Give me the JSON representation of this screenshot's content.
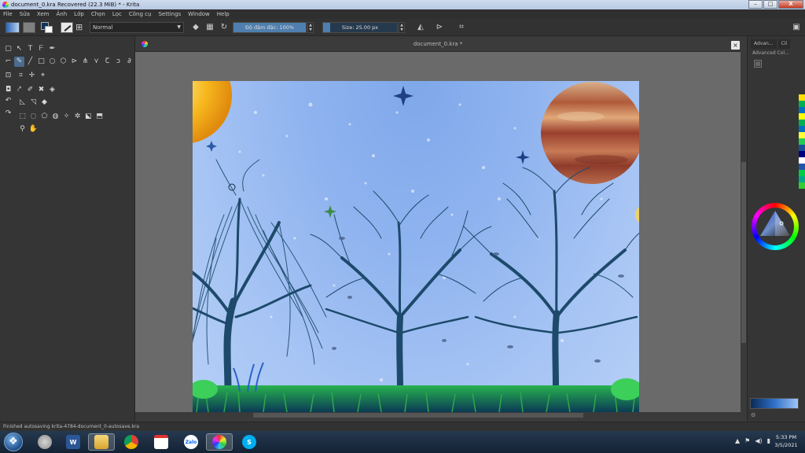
{
  "window": {
    "title": "document_0.kra Recovered  (22.3 MiB)  * - Krita",
    "minimize_label": "–",
    "maximize_label": "□",
    "close_label": "X"
  },
  "menu": [
    "File",
    "Sửa",
    "Xem",
    "Ảnh",
    "Lớp",
    "Chọn",
    "Lọc",
    "Công cụ",
    "Settings",
    "Window",
    "Help"
  ],
  "toolbar": {
    "blend_mode": "Normal",
    "opacity_label": "Độ đậm đặc: 100%",
    "opacity_value": 100,
    "size_label": "Size: 25.00 px",
    "size_fill": 0.1
  },
  "document": {
    "tab_title": "document_0.kra *",
    "close_label": "×"
  },
  "docker": {
    "tabs": [
      "Advan...",
      "Cil"
    ],
    "title": "Advanced Col...",
    "palette": [
      "#ffe000",
      "#00b050",
      "#0070c0",
      "#ffff00",
      "#00b050",
      "#0070c0",
      "#ffff33",
      "#22cc55",
      "#1b4f9c",
      "#000080",
      "#ffffff",
      "#2255aa",
      "#00cc44",
      "#00aa88",
      "#33cc33"
    ]
  },
  "status": {
    "message": "Finished autosaving krita-4784-document_0-autosave.kra"
  },
  "taskbar": {
    "word_label": "W",
    "zalo_label": "Zalo",
    "skype_label": "S",
    "clock_time": "5:33 PM",
    "clock_date": "3/5/2021"
  },
  "colors": {
    "accent": "#4f7fae",
    "tree": "#1d4a6b",
    "grass": "#2ea84a"
  }
}
